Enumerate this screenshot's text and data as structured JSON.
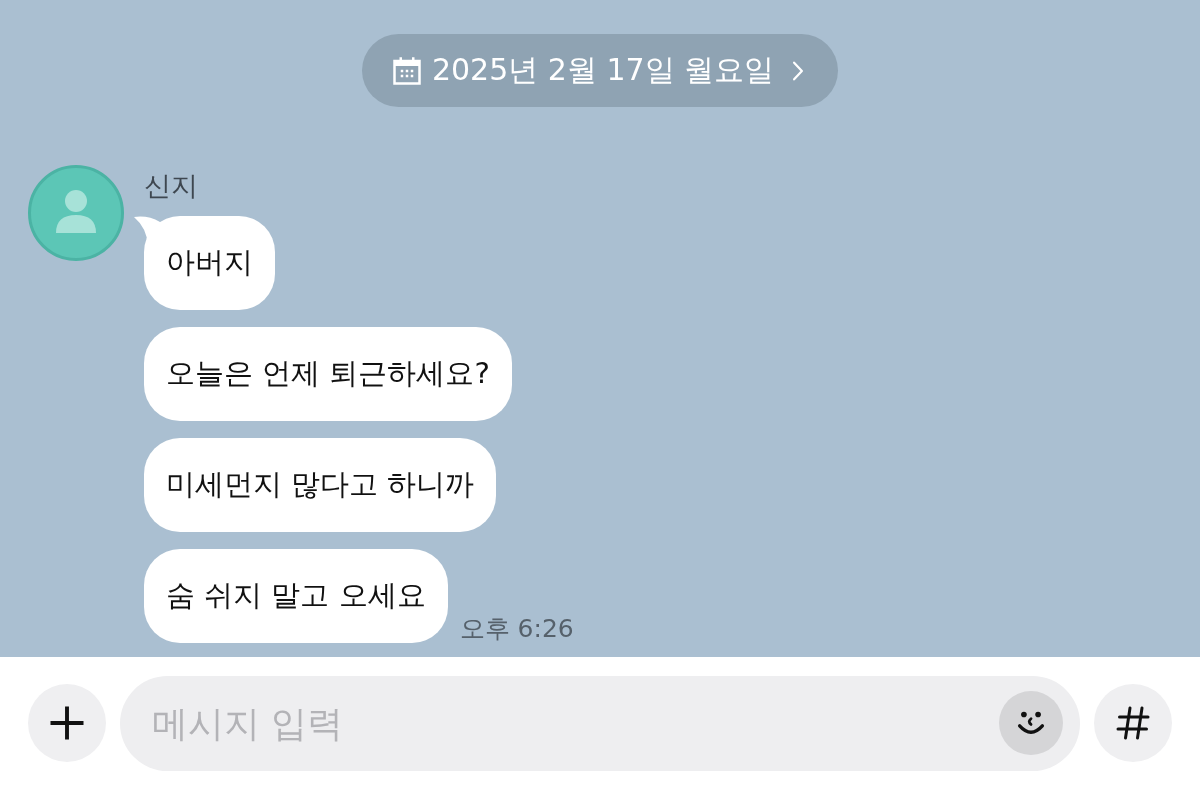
{
  "date_divider": {
    "label": "2025년 2월 17일 월요일"
  },
  "message_groups": [
    {
      "sender": "신지",
      "bubbles": [
        "아버지",
        "오늘은 언제 퇴근하세요?",
        "미세먼지 많다고 하니까",
        "숨 쉬지 말고 오세요"
      ],
      "time": "오후 6:26"
    }
  ],
  "composer": {
    "placeholder": "메시지 입력"
  }
}
